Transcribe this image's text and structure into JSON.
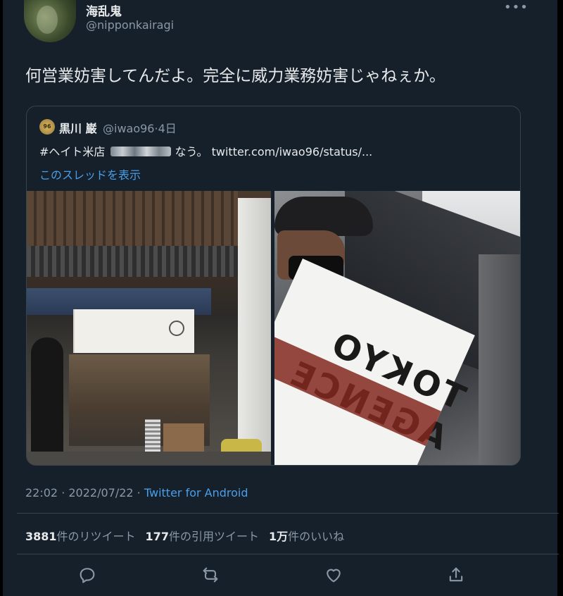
{
  "author": {
    "display_name": "海乱鬼",
    "handle": "@nipponkairagi"
  },
  "tweet": {
    "text": "何営業妨害してんだよ。完全に威力業務妨害じゃねぇか。"
  },
  "quoted_tweet": {
    "avatar_text": "96",
    "display_name": "黒川 巌",
    "handle_time": "@iwao96·4日",
    "text_prefix": "#ヘイト米店 ",
    "text_suffix": "なう。 twitter.com/iwao96/status/...",
    "thread_link": "このスレッドを表示",
    "photo_sign_text": "TOKYO AGENCE"
  },
  "meta": {
    "time": "22:02",
    "sep1": " · ",
    "date": "2022/07/22",
    "sep2": " · ",
    "source": "Twitter for Android"
  },
  "stats": {
    "retweets_count": "3881",
    "retweets_label": "件のリツイート",
    "quotes_count": "177",
    "quotes_label": "件の引用ツイート",
    "likes_count": "1万",
    "likes_label": "件のいいね"
  },
  "icons": {
    "more": "more-icon",
    "reply": "reply-icon",
    "retweet": "retweet-icon",
    "like": "heart-icon",
    "share": "share-icon"
  },
  "colors": {
    "background": "#15202b",
    "text": "#e7e9ea",
    "muted": "#8b98a5",
    "link": "#4a9fe9",
    "border": "#38444d"
  }
}
